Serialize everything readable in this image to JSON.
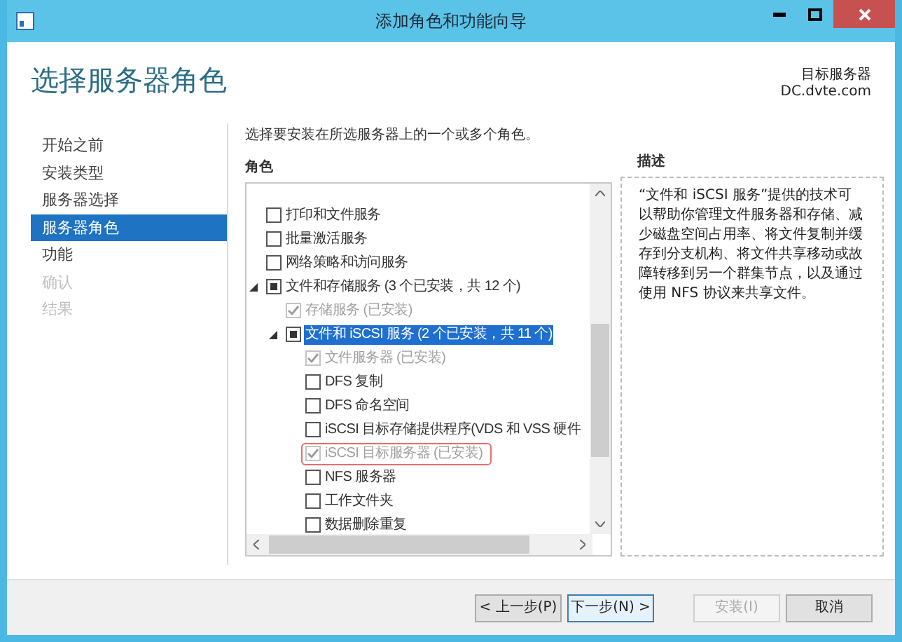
{
  "window": {
    "title": "添加角色和功能向导"
  },
  "header": {
    "title": "选择服务器角色",
    "target_label": "目标服务器",
    "target_server": "DC.dvte.com"
  },
  "sidebar": {
    "items": [
      {
        "label": "开始之前",
        "selected": false,
        "disabled": false
      },
      {
        "label": "安装类型",
        "selected": false,
        "disabled": false
      },
      {
        "label": "服务器选择",
        "selected": false,
        "disabled": false
      },
      {
        "label": "服务器角色",
        "selected": true,
        "disabled": false
      },
      {
        "label": "功能",
        "selected": false,
        "disabled": false
      },
      {
        "label": "确认",
        "selected": false,
        "disabled": true
      },
      {
        "label": "结果",
        "selected": false,
        "disabled": true
      }
    ]
  },
  "instruction": "选择要安装在所选服务器上的一个或多个角色。",
  "roles": {
    "label": "角色",
    "items": [
      {
        "label": "打印和文件服务",
        "checked": false,
        "indeterminate": false,
        "disabled": false,
        "selected": false,
        "outlined": false
      },
      {
        "label": "批量激活服务",
        "checked": false,
        "indeterminate": false,
        "disabled": false,
        "selected": false,
        "outlined": false
      },
      {
        "label": "网络策略和访问服务",
        "checked": false,
        "indeterminate": false,
        "disabled": false,
        "selected": false,
        "outlined": false
      },
      {
        "label": "文件和存储服务 (3 个已安装，共 12 个)",
        "checked": false,
        "indeterminate": true,
        "disabled": false,
        "selected": false,
        "outlined": false,
        "expanded": true,
        "children": [
          {
            "label": "存储服务 (已安装)",
            "checked": true,
            "indeterminate": false,
            "disabled": true,
            "selected": false,
            "outlined": false
          },
          {
            "label": "文件和 iSCSI 服务 (2 个已安装，共 11 个)",
            "checked": false,
            "indeterminate": true,
            "disabled": false,
            "selected": true,
            "outlined": false,
            "expanded": true,
            "children": [
              {
                "label": "文件服务器 (已安装)",
                "checked": true,
                "indeterminate": false,
                "disabled": true,
                "selected": false,
                "outlined": false
              },
              {
                "label": "DFS 复制",
                "checked": false,
                "indeterminate": false,
                "disabled": false,
                "selected": false,
                "outlined": false
              },
              {
                "label": "DFS 命名空间",
                "checked": false,
                "indeterminate": false,
                "disabled": false,
                "selected": false,
                "outlined": false
              },
              {
                "label": "iSCSI 目标存储提供程序(VDS 和 VSS 硬件",
                "checked": false,
                "indeterminate": false,
                "disabled": false,
                "selected": false,
                "outlined": false
              },
              {
                "label": "iSCSI 目标服务器 (已安装)",
                "checked": true,
                "indeterminate": false,
                "disabled": true,
                "selected": false,
                "outlined": true
              },
              {
                "label": "NFS 服务器",
                "checked": false,
                "indeterminate": false,
                "disabled": false,
                "selected": false,
                "outlined": false
              },
              {
                "label": "工作文件夹",
                "checked": false,
                "indeterminate": false,
                "disabled": false,
                "selected": false,
                "outlined": false
              },
              {
                "label": "数据删除重复",
                "checked": false,
                "indeterminate": false,
                "disabled": false,
                "selected": false,
                "outlined": false
              }
            ]
          }
        ]
      }
    ]
  },
  "description": {
    "label": "描述",
    "text": "“文件和 iSCSI 服务”提供的技术可以帮助你管理文件服务器和存储、减少磁盘空间占用率、将文件复制并缓存到分支机构、将文件共享移动或故障转移到另一个群集节点，以及通过使用 NFS 协议来共享文件。"
  },
  "buttons": [
    {
      "label": "< 上一步(P)",
      "disabled": false,
      "focused": false
    },
    {
      "label": "下一步(N) >",
      "disabled": false,
      "focused": true
    },
    {
      "label": "安装(I)",
      "disabled": true,
      "focused": false
    },
    {
      "label": "取消",
      "disabled": false,
      "focused": false
    }
  ]
}
